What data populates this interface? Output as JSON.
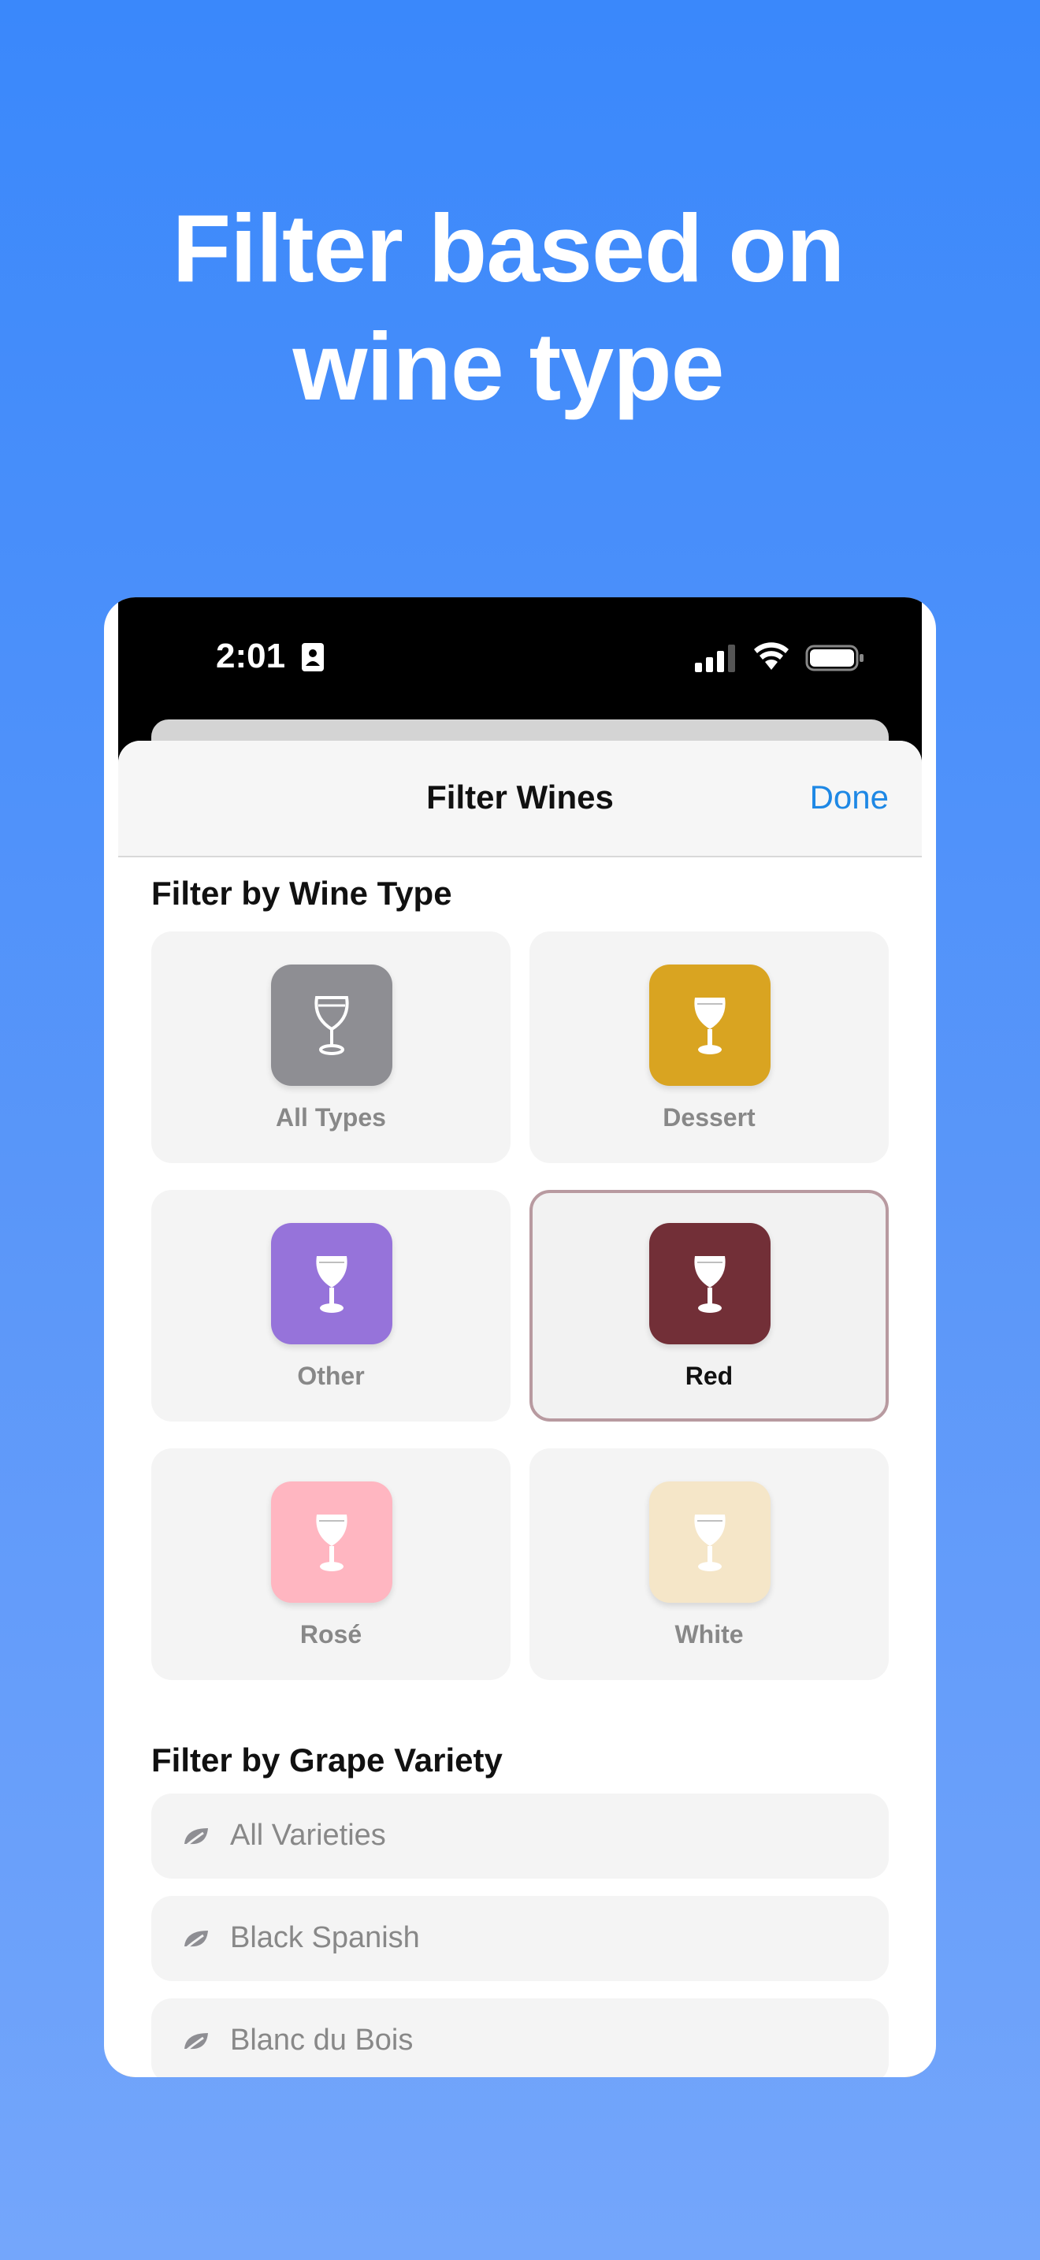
{
  "headline": {
    "line1": "Filter based on",
    "line2": "wine type"
  },
  "status_bar": {
    "time": "2:01"
  },
  "nav": {
    "title": "Filter Wines",
    "done_label": "Done"
  },
  "wine_type_section": {
    "title": "Filter by Wine Type",
    "types": [
      {
        "label": "All Types",
        "color": "#8e8e93",
        "glass": "outline",
        "selected": false
      },
      {
        "label": "Dessert",
        "color": "#d9a421",
        "glass": "filled",
        "selected": false
      },
      {
        "label": "Other",
        "color": "#9673da",
        "glass": "filled",
        "selected": false
      },
      {
        "label": "Red",
        "color": "#722f37",
        "glass": "filled",
        "selected": true
      },
      {
        "label": "Rosé",
        "color": "#ffb6c1",
        "glass": "filled",
        "selected": false
      },
      {
        "label": "White",
        "color": "#f5e6c8",
        "glass": "filled",
        "selected": false
      }
    ]
  },
  "grape_section": {
    "title": "Filter by Grape Variety",
    "varieties": [
      {
        "label": "All Varieties",
        "icon": "leaf-icon"
      },
      {
        "label": "Black Spanish",
        "icon": "leaf-icon"
      },
      {
        "label": "Blanc du Bois",
        "icon": "leaf-icon"
      }
    ]
  },
  "colors": {
    "accent": "#1e88e5",
    "background": "#3a88fb"
  }
}
